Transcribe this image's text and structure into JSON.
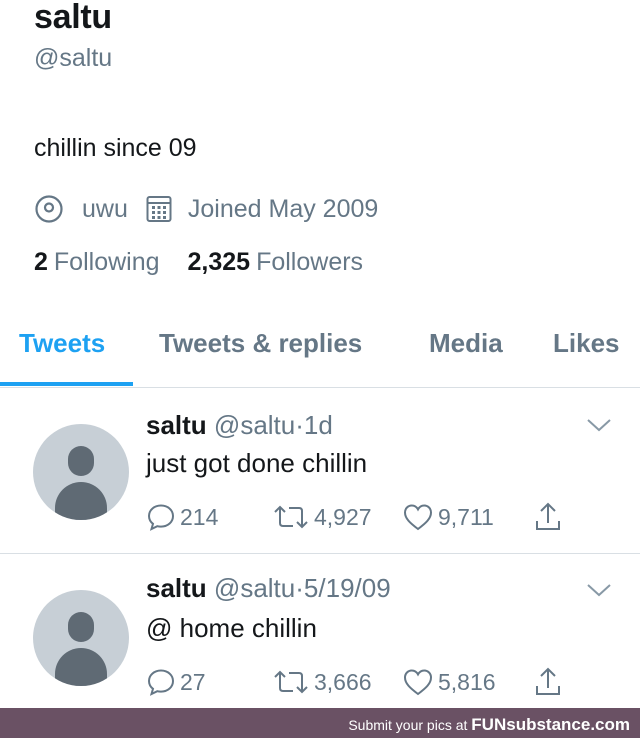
{
  "profile": {
    "display_name": "saltu",
    "handle": "@saltu",
    "bio": "chillin since 09",
    "location": "uwu",
    "joined": "Joined May 2009",
    "following_count": "2",
    "following_label": "Following",
    "followers_count": "2,325",
    "followers_label": "Followers"
  },
  "tabs": [
    {
      "label": "Tweets",
      "active": true
    },
    {
      "label": "Tweets & replies",
      "active": false
    },
    {
      "label": "Media",
      "active": false
    },
    {
      "label": "Likes",
      "active": false
    }
  ],
  "tweets": [
    {
      "name": "saltu",
      "handle": "@saltu",
      "separator": "·",
      "time": "1d",
      "text": "just got done chillin",
      "replies": "214",
      "retweets": "4,927",
      "likes": "9,711"
    },
    {
      "name": "saltu",
      "handle": "@saltu",
      "separator": "·",
      "time": "5/19/09",
      "text": "@ home chillin",
      "replies": "27",
      "retweets": "3,666",
      "likes": "5,816"
    }
  ],
  "footer": {
    "prefix": "Submit your pics at",
    "brand": "FUNsubstance.com"
  },
  "colors": {
    "accent": "#1da1f2",
    "secondary_text": "#657786",
    "footer_bg": "#6a5164"
  }
}
